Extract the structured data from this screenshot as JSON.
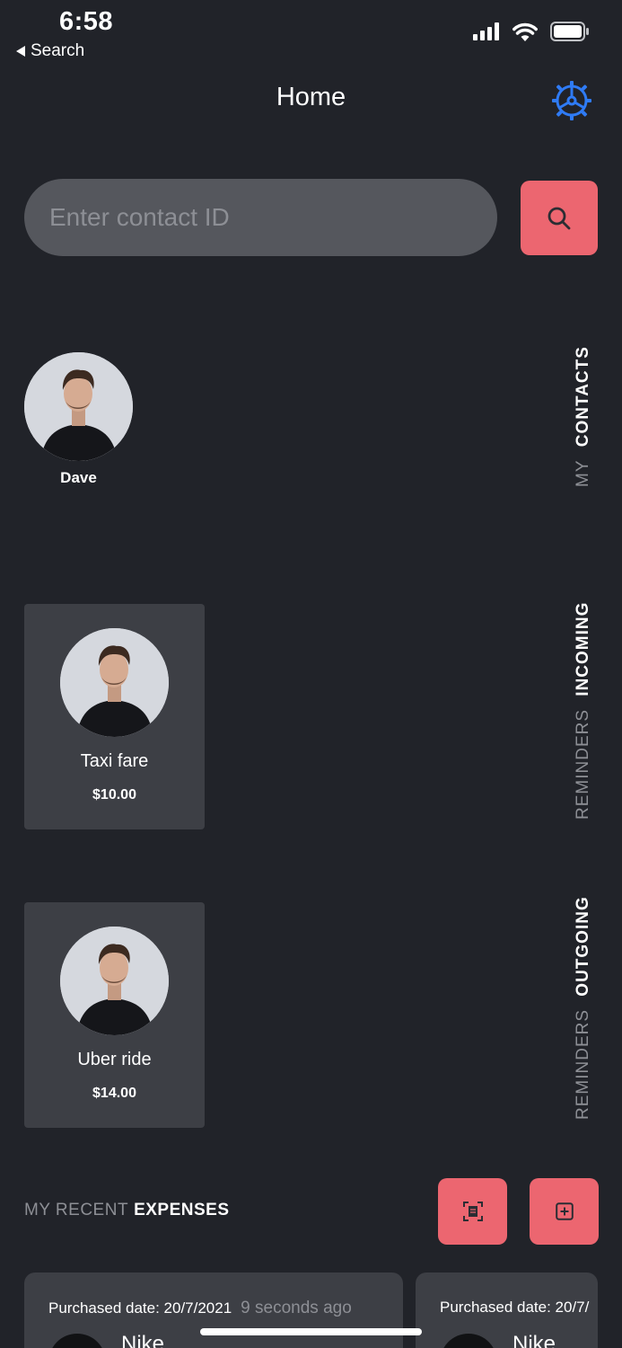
{
  "status_bar": {
    "time": "6:58",
    "back_label": "Search",
    "icons": [
      "signal-icon",
      "wifi-icon",
      "battery-icon"
    ]
  },
  "header": {
    "title": "Home",
    "settings_icon": "settings-icon"
  },
  "search": {
    "placeholder": "Enter contact ID",
    "value": "",
    "button_icon": "search-icon"
  },
  "contacts": {
    "label_prefix": "MY",
    "label_main": "CONTACTS",
    "items": [
      {
        "name": "Dave"
      }
    ]
  },
  "incoming": {
    "label_prefix": "REMINDERS",
    "label_main": "INCOMING",
    "items": [
      {
        "title": "Taxi fare",
        "amount": "$10.00"
      }
    ]
  },
  "outgoing": {
    "label_prefix": "REMINDERS",
    "label_main": "OUTGOING",
    "items": [
      {
        "title": "Uber ride",
        "amount": "$14.00"
      }
    ]
  },
  "expenses": {
    "label_prefix": "MY RECENT",
    "label_main": "EXPENSES",
    "scan_icon": "scan-receipt-icon",
    "add_icon": "add-icon",
    "items": [
      {
        "purchased": "Purchased date: 20/7/2021",
        "ago": "9 seconds ago",
        "merchant": "Nike"
      },
      {
        "purchased": "Purchased date: 20/7/",
        "ago": "",
        "merchant": "Nike"
      }
    ]
  },
  "colors": {
    "background": "#212329",
    "card": "#3d3f45",
    "accent": "#ec6670",
    "input": "#55575d",
    "settings_blue": "#2f7bf5",
    "muted_text": "#8d8f95"
  }
}
